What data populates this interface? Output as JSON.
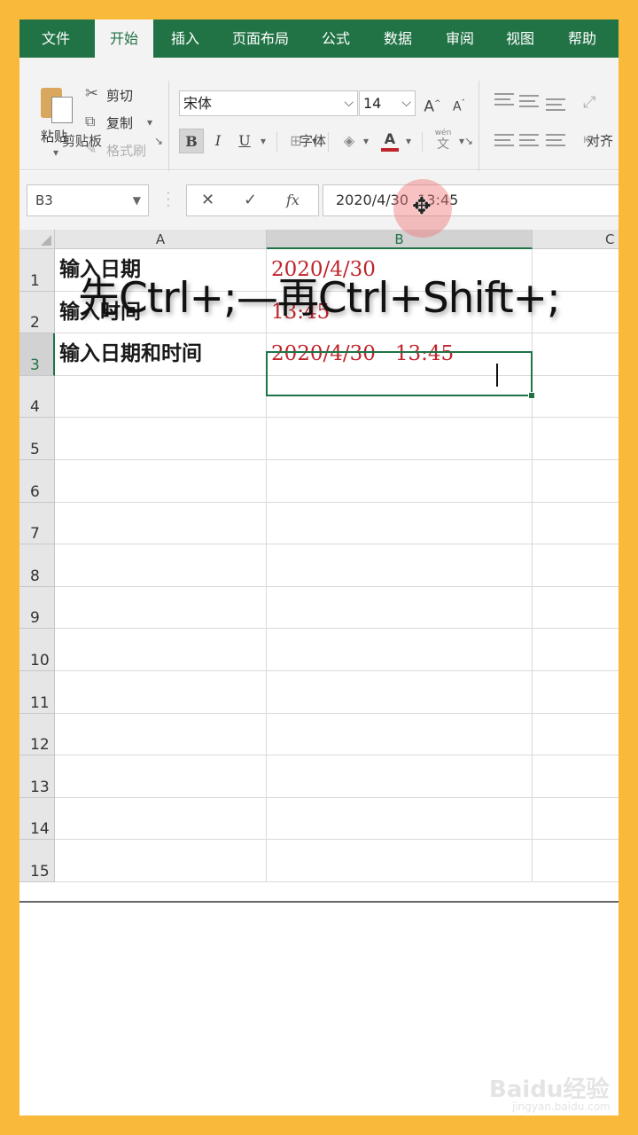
{
  "ribbon": {
    "tabs": [
      {
        "label": "文件",
        "active": false
      },
      {
        "label": "开始",
        "active": true
      },
      {
        "label": "插入",
        "active": false
      },
      {
        "label": "页面布局",
        "active": false
      },
      {
        "label": "公式",
        "active": false
      },
      {
        "label": "数据",
        "active": false
      },
      {
        "label": "审阅",
        "active": false
      },
      {
        "label": "视图",
        "active": false
      },
      {
        "label": "帮助",
        "active": false
      }
    ],
    "clipboard": {
      "paste": "粘贴",
      "cut": "剪切",
      "copy": "复制",
      "format_painter": "格式刷",
      "group_label": "剪贴板"
    },
    "font": {
      "name": "宋体",
      "size": "14",
      "bold": "B",
      "italic": "I",
      "underline": "U",
      "font_color_letter": "A",
      "phonetic": "wén",
      "phonetic_char": "文",
      "group_label": "字体"
    },
    "alignment": {
      "group_label": "对齐"
    }
  },
  "formula_bar": {
    "name_box": "B3",
    "cancel": "✕",
    "enter": "✓",
    "fx": "fx",
    "content": "2020/4/30  13:45"
  },
  "sheet": {
    "columns": [
      "A",
      "B",
      "C"
    ],
    "selected_column": "B",
    "selected_row": 3,
    "rows": [
      {
        "num": "1",
        "a": "输入日期",
        "b": "2020/4/30"
      },
      {
        "num": "2",
        "a": "输入时间",
        "b": "13:45"
      },
      {
        "num": "3",
        "a": "输入日期和时间",
        "b": "2020/4/30   13:45"
      },
      {
        "num": "4",
        "a": "",
        "b": ""
      },
      {
        "num": "5",
        "a": "",
        "b": ""
      },
      {
        "num": "6",
        "a": "",
        "b": ""
      },
      {
        "num": "7",
        "a": "",
        "b": ""
      },
      {
        "num": "8",
        "a": "",
        "b": ""
      },
      {
        "num": "9",
        "a": "",
        "b": ""
      },
      {
        "num": "10",
        "a": "",
        "b": ""
      },
      {
        "num": "11",
        "a": "",
        "b": ""
      },
      {
        "num": "12",
        "a": "",
        "b": ""
      },
      {
        "num": "13",
        "a": "",
        "b": ""
      },
      {
        "num": "14",
        "a": "",
        "b": ""
      },
      {
        "num": "15",
        "a": "",
        "b": ""
      }
    ]
  },
  "overlay_caption": "先Ctrl+;—再Ctrl+Shift+;",
  "cursor_icon": "move-crosshair-icon",
  "watermark": {
    "main": "Baidu经验",
    "sub": "jingyan.baidu.com"
  },
  "colors": {
    "excel_green": "#217346",
    "value_red": "#c0242b",
    "frame_orange": "#f9b93a"
  }
}
